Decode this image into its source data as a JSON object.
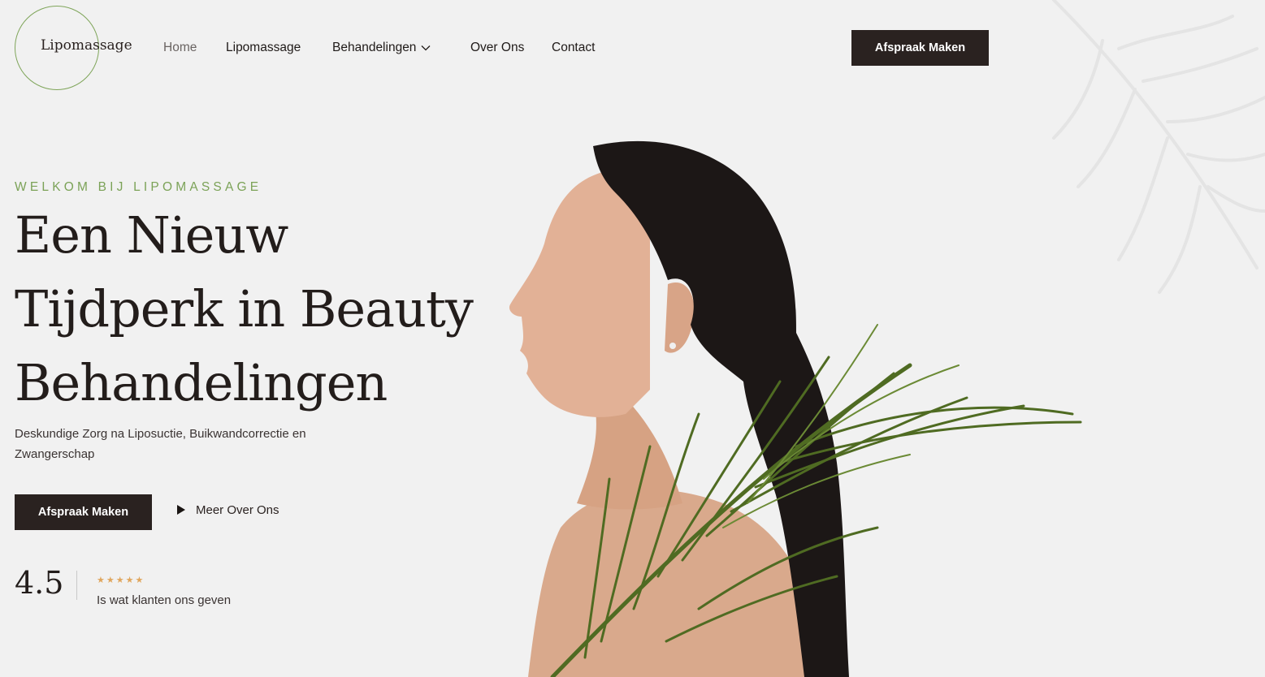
{
  "brand": {
    "name": "Lipomassage",
    "accent_color": "#7ba257",
    "dark_color": "#2a2220"
  },
  "nav": {
    "items": [
      {
        "label": "Home",
        "active": true
      },
      {
        "label": "Lipomassage"
      },
      {
        "label": "Behandelingen",
        "has_dropdown": true,
        "icon": "chevron-down-icon"
      },
      {
        "label": "Over Ons"
      },
      {
        "label": "Contact"
      }
    ],
    "cta_label": "Afspraak Maken"
  },
  "hero": {
    "eyebrow": "WELKOM BIJ LIPOMASSAGE",
    "headline": [
      "Een Nieuw",
      "Tijdperk in Beauty",
      "Behandelingen"
    ],
    "subtitle": "Deskundige Zorg na Liposuctie, Buikwandcorrectie en Zwangerschap",
    "primary_button": "Afspraak Maken",
    "secondary_link": "Meer Over Ons",
    "secondary_icon": "play-icon"
  },
  "rating": {
    "value": "4.5",
    "stars": "★★★★★",
    "star_color": "#e0a65d",
    "caption": "Is wat klanten ons geven"
  }
}
